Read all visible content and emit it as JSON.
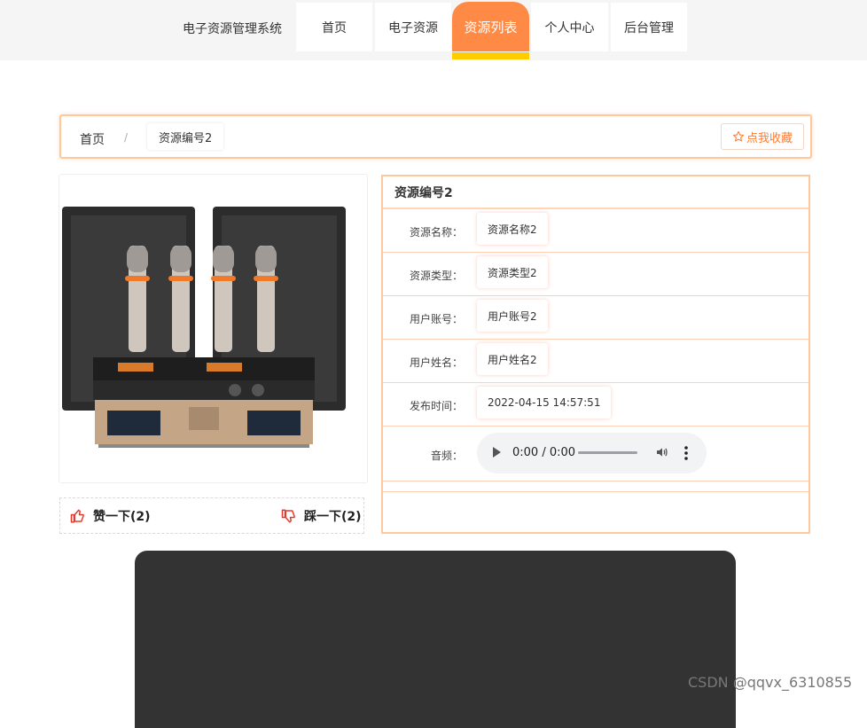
{
  "header": {
    "brand": "电子资源管理系统",
    "nav": [
      {
        "label": "首页"
      },
      {
        "label": "电子资源"
      },
      {
        "label": "资源列表"
      },
      {
        "label": "个人中心"
      },
      {
        "label": "后台管理"
      }
    ]
  },
  "breadcrumb": {
    "home": "首页",
    "separator": "/",
    "current": "资源编号2",
    "favorite_label": "点我收藏"
  },
  "votes": {
    "like_label": "赞一下(2)",
    "dislike_label": "踩一下(2)"
  },
  "details": {
    "title": "资源编号2",
    "rows": [
      {
        "label": "资源名称：",
        "value": "资源名称2"
      },
      {
        "label": "资源类型：",
        "value": "资源类型2"
      },
      {
        "label": "用户账号：",
        "value": "用户账号2"
      },
      {
        "label": "用户姓名：",
        "value": "用户姓名2"
      },
      {
        "label": "发布时间：",
        "value": "2022-04-15 14:57:51"
      }
    ],
    "audio": {
      "label": "音频：",
      "time": "0:00 / 0:00"
    }
  },
  "watermark": "CSDN @qqvx_6310855",
  "colors": {
    "accent": "#ff8a45",
    "accent_bar": "#ffcc00",
    "border": "#ffc79c"
  }
}
